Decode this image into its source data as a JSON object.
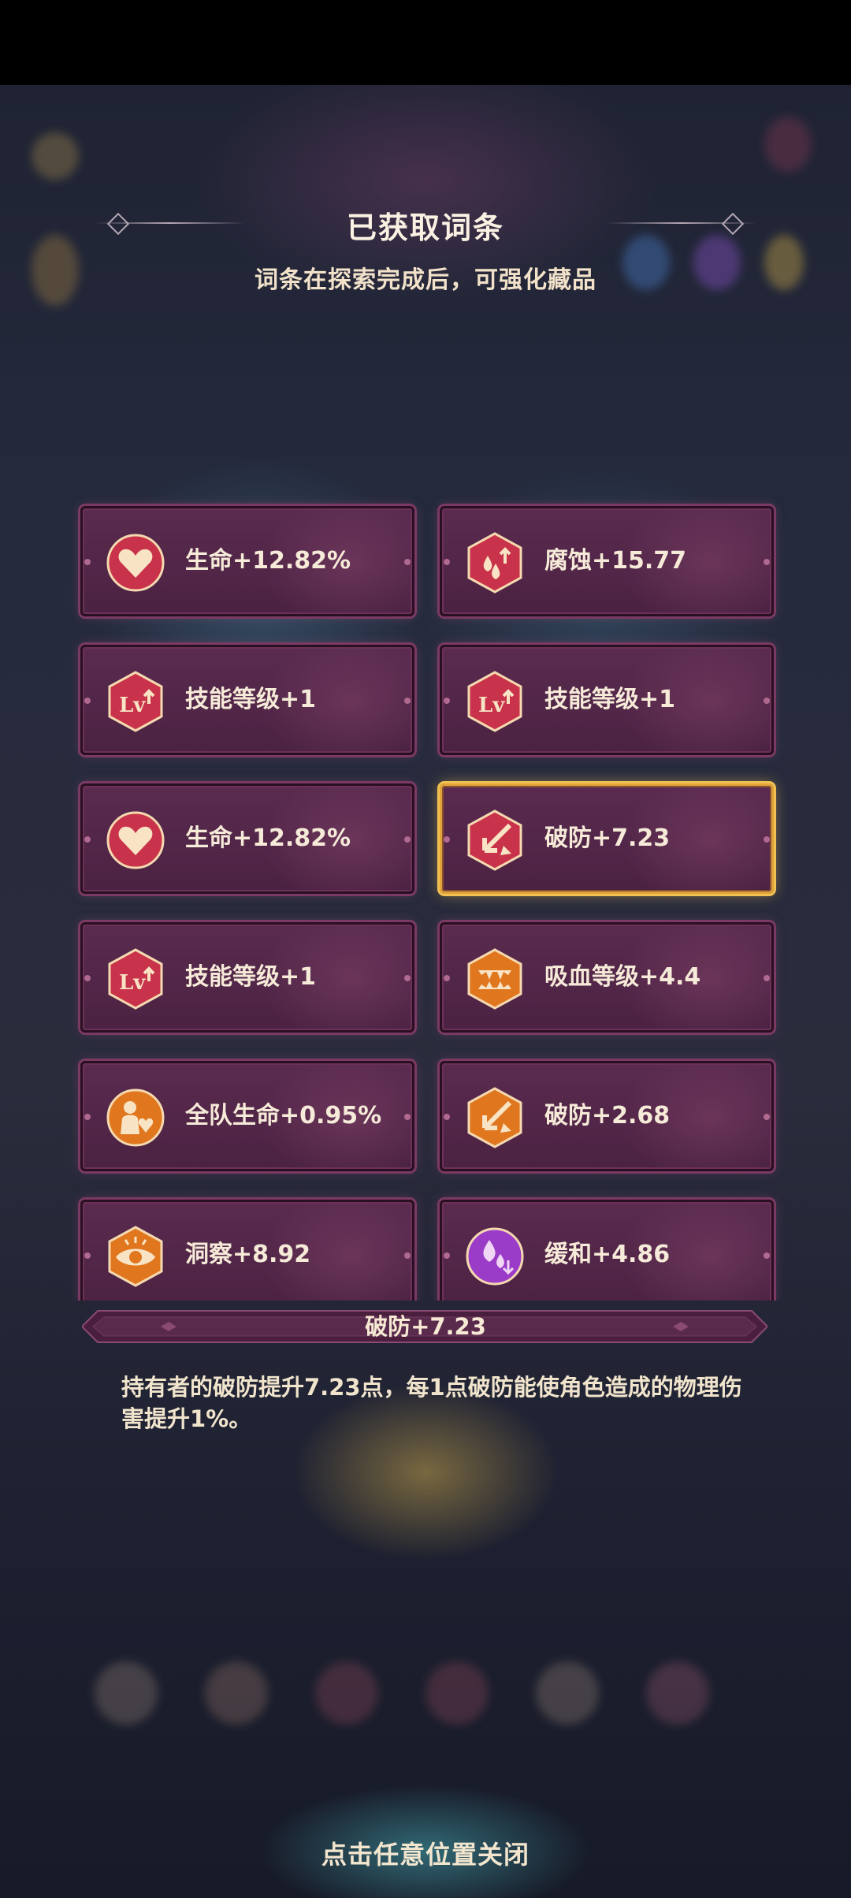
{
  "panel": {
    "title": "已获取词条",
    "subtitle": "词条在探索完成后，可强化藏品"
  },
  "affixes": [
    {
      "label": "生命+12.82%",
      "icon": "heart-icon",
      "color": "#c8324a"
    },
    {
      "label": "腐蚀+15.77",
      "icon": "corrosion-drops-icon",
      "color": "#c8324a"
    },
    {
      "label": "技能等级+1",
      "icon": "skill-level-up-icon",
      "color": "#c8324a"
    },
    {
      "label": "技能等级+1",
      "icon": "skill-level-up-icon",
      "color": "#c8324a"
    },
    {
      "label": "生命+12.82%",
      "icon": "heart-icon",
      "color": "#c8324a"
    },
    {
      "label": "破防+7.23",
      "icon": "armor-break-arrow-icon",
      "color": "#c8324a",
      "selected": true
    },
    {
      "label": "技能等级+1",
      "icon": "skill-level-up-icon",
      "color": "#c8324a"
    },
    {
      "label": "吸血等级+4.4",
      "icon": "lifesteal-fangs-icon",
      "color": "#e0761e"
    },
    {
      "label": "全队生命+0.95%",
      "icon": "team-health-icon",
      "color": "#e0761e"
    },
    {
      "label": "破防+2.68",
      "icon": "armor-break-arrow-icon",
      "color": "#e0761e"
    },
    {
      "label": "洞察+8.92",
      "icon": "insight-eye-icon",
      "color": "#e0761e"
    },
    {
      "label": "缓和+4.86",
      "icon": "ease-drops-icon",
      "color": "#9a3cc8"
    }
  ],
  "detail": {
    "name": "破防+7.23",
    "description": "持有者的破防提升7.23点，每1点破防能使角色造成的物理伤害提升1%。"
  },
  "close_hint": "点击任意位置关闭"
}
